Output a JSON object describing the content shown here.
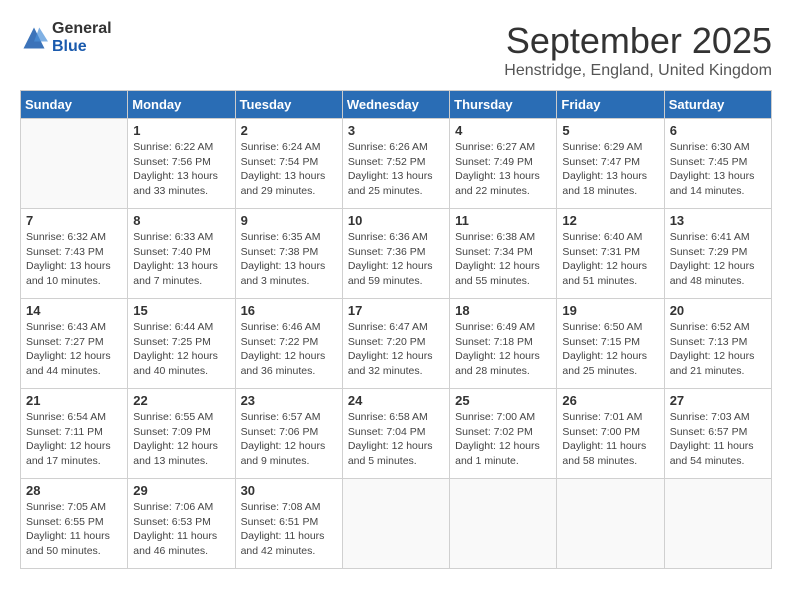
{
  "logo": {
    "general": "General",
    "blue": "Blue"
  },
  "title": "September 2025",
  "location": "Henstridge, England, United Kingdom",
  "days_of_week": [
    "Sunday",
    "Monday",
    "Tuesday",
    "Wednesday",
    "Thursday",
    "Friday",
    "Saturday"
  ],
  "weeks": [
    [
      {
        "num": "",
        "info": ""
      },
      {
        "num": "1",
        "info": "Sunrise: 6:22 AM\nSunset: 7:56 PM\nDaylight: 13 hours\nand 33 minutes."
      },
      {
        "num": "2",
        "info": "Sunrise: 6:24 AM\nSunset: 7:54 PM\nDaylight: 13 hours\nand 29 minutes."
      },
      {
        "num": "3",
        "info": "Sunrise: 6:26 AM\nSunset: 7:52 PM\nDaylight: 13 hours\nand 25 minutes."
      },
      {
        "num": "4",
        "info": "Sunrise: 6:27 AM\nSunset: 7:49 PM\nDaylight: 13 hours\nand 22 minutes."
      },
      {
        "num": "5",
        "info": "Sunrise: 6:29 AM\nSunset: 7:47 PM\nDaylight: 13 hours\nand 18 minutes."
      },
      {
        "num": "6",
        "info": "Sunrise: 6:30 AM\nSunset: 7:45 PM\nDaylight: 13 hours\nand 14 minutes."
      }
    ],
    [
      {
        "num": "7",
        "info": "Sunrise: 6:32 AM\nSunset: 7:43 PM\nDaylight: 13 hours\nand 10 minutes."
      },
      {
        "num": "8",
        "info": "Sunrise: 6:33 AM\nSunset: 7:40 PM\nDaylight: 13 hours\nand 7 minutes."
      },
      {
        "num": "9",
        "info": "Sunrise: 6:35 AM\nSunset: 7:38 PM\nDaylight: 13 hours\nand 3 minutes."
      },
      {
        "num": "10",
        "info": "Sunrise: 6:36 AM\nSunset: 7:36 PM\nDaylight: 12 hours\nand 59 minutes."
      },
      {
        "num": "11",
        "info": "Sunrise: 6:38 AM\nSunset: 7:34 PM\nDaylight: 12 hours\nand 55 minutes."
      },
      {
        "num": "12",
        "info": "Sunrise: 6:40 AM\nSunset: 7:31 PM\nDaylight: 12 hours\nand 51 minutes."
      },
      {
        "num": "13",
        "info": "Sunrise: 6:41 AM\nSunset: 7:29 PM\nDaylight: 12 hours\nand 48 minutes."
      }
    ],
    [
      {
        "num": "14",
        "info": "Sunrise: 6:43 AM\nSunset: 7:27 PM\nDaylight: 12 hours\nand 44 minutes."
      },
      {
        "num": "15",
        "info": "Sunrise: 6:44 AM\nSunset: 7:25 PM\nDaylight: 12 hours\nand 40 minutes."
      },
      {
        "num": "16",
        "info": "Sunrise: 6:46 AM\nSunset: 7:22 PM\nDaylight: 12 hours\nand 36 minutes."
      },
      {
        "num": "17",
        "info": "Sunrise: 6:47 AM\nSunset: 7:20 PM\nDaylight: 12 hours\nand 32 minutes."
      },
      {
        "num": "18",
        "info": "Sunrise: 6:49 AM\nSunset: 7:18 PM\nDaylight: 12 hours\nand 28 minutes."
      },
      {
        "num": "19",
        "info": "Sunrise: 6:50 AM\nSunset: 7:15 PM\nDaylight: 12 hours\nand 25 minutes."
      },
      {
        "num": "20",
        "info": "Sunrise: 6:52 AM\nSunset: 7:13 PM\nDaylight: 12 hours\nand 21 minutes."
      }
    ],
    [
      {
        "num": "21",
        "info": "Sunrise: 6:54 AM\nSunset: 7:11 PM\nDaylight: 12 hours\nand 17 minutes."
      },
      {
        "num": "22",
        "info": "Sunrise: 6:55 AM\nSunset: 7:09 PM\nDaylight: 12 hours\nand 13 minutes."
      },
      {
        "num": "23",
        "info": "Sunrise: 6:57 AM\nSunset: 7:06 PM\nDaylight: 12 hours\nand 9 minutes."
      },
      {
        "num": "24",
        "info": "Sunrise: 6:58 AM\nSunset: 7:04 PM\nDaylight: 12 hours\nand 5 minutes."
      },
      {
        "num": "25",
        "info": "Sunrise: 7:00 AM\nSunset: 7:02 PM\nDaylight: 12 hours\nand 1 minute."
      },
      {
        "num": "26",
        "info": "Sunrise: 7:01 AM\nSunset: 7:00 PM\nDaylight: 11 hours\nand 58 minutes."
      },
      {
        "num": "27",
        "info": "Sunrise: 7:03 AM\nSunset: 6:57 PM\nDaylight: 11 hours\nand 54 minutes."
      }
    ],
    [
      {
        "num": "28",
        "info": "Sunrise: 7:05 AM\nSunset: 6:55 PM\nDaylight: 11 hours\nand 50 minutes."
      },
      {
        "num": "29",
        "info": "Sunrise: 7:06 AM\nSunset: 6:53 PM\nDaylight: 11 hours\nand 46 minutes."
      },
      {
        "num": "30",
        "info": "Sunrise: 7:08 AM\nSunset: 6:51 PM\nDaylight: 11 hours\nand 42 minutes."
      },
      {
        "num": "",
        "info": ""
      },
      {
        "num": "",
        "info": ""
      },
      {
        "num": "",
        "info": ""
      },
      {
        "num": "",
        "info": ""
      }
    ]
  ]
}
